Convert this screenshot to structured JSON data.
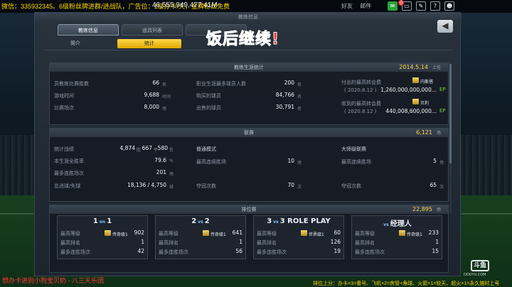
{
  "stream": {
    "marquee": "微信：335932345。6级粉丝牌进群/进战队，广告位：1级办卡/天，金牌粉丝免费",
    "money": "46,555,949,477.41M",
    "top_links": [
      "好友",
      "邮件"
    ],
    "notif_count": "0",
    "bottom_left": "想办卡进别小狗宝贝奶 - 八三天乐团",
    "bottom_right": "排位上分：办卡×3=看号、飞机×2=房管+角球、火箭×1=较天、超火×1=永久随时上号",
    "logo_text": "斗鱼",
    "logo_url": "DOUYU.COM"
  },
  "overlay_caption": "饭后继续!",
  "panel": {
    "title": "教练信息",
    "tabs": [
      "教练信息",
      "道具列表",
      ""
    ],
    "subtabs": [
      "简介",
      "统计"
    ],
    "back_icon": "back-arrow-icon"
  },
  "career": {
    "title": "教练生涯统计",
    "date": "2014.5.14",
    "date_suffix": "上任",
    "col1": [
      {
        "label": "员教练比赛胜数",
        "value": "66",
        "unit": "名"
      },
      {
        "label": "游戏时间",
        "value": "9,688",
        "unit": "时间"
      },
      {
        "label": "比赛场次",
        "value": "8,000",
        "unit": "场"
      }
    ],
    "col2": [
      {
        "label": "职业生涯最多球员人数",
        "value": "200",
        "unit": "名"
      },
      {
        "label": "购买的球员",
        "value": "84,766",
        "unit": "名"
      },
      {
        "label": "出售的球员",
        "value": "30,791",
        "unit": "名"
      }
    ],
    "col3": [
      {
        "label": "付出的最高转会费",
        "date": "( 2020.8.12 )",
        "value": "1,260,000,000,000...",
        "player": "内斯塔",
        "ep": "EP"
      },
      {
        "label": "收到的最高转会费",
        "date": "( 2020.8.12 )",
        "value": "440,008,600,000...",
        "player": "贝利",
        "ep": "EP"
      }
    ]
  },
  "league": {
    "title": "联赛",
    "score": "6,121",
    "score_unit": "场",
    "col1": [
      {
        "label": "统计战绩",
        "w": "4,874",
        "d": "667",
        "l": "580",
        "unit": "胜"
      },
      {
        "label": "本生涯全胜率",
        "value": "79.6",
        "unit": "%"
      },
      {
        "label": "最多连胜场次",
        "value": "201",
        "unit": "场"
      },
      {
        "label": "总进球/失球",
        "value": "18,136 / 4,750",
        "unit": "球"
      }
    ],
    "col2": [
      {
        "label": "普通模式",
        "value": "",
        "unit": ""
      },
      {
        "label": "最高连续胜场",
        "value": "10",
        "unit": "场"
      },
      {
        "label": "夺冠次数",
        "value": "70",
        "unit": "次"
      }
    ],
    "col3": [
      {
        "label": "大师级联赛",
        "value": "",
        "unit": ""
      },
      {
        "label": "最高连续胜场",
        "value": "5",
        "unit": "场"
      },
      {
        "label": "夺冠次数",
        "value": "65",
        "unit": "次"
      }
    ]
  },
  "ranked": {
    "title": "排位赛",
    "score": "22,895",
    "score_unit": "场",
    "modes": [
      {
        "title": "1",
        "sub": "on",
        "title2": "1",
        "rows": [
          {
            "label": "最高等级",
            "badge": "传奇级1",
            "value": "902"
          },
          {
            "label": "最高排名",
            "badge": "",
            "value": "1"
          },
          {
            "label": "最多连胜场次",
            "badge": "",
            "value": "42"
          }
        ]
      },
      {
        "title": "2",
        "sub": "vs",
        "title2": "2",
        "rows": [
          {
            "label": "最高等级",
            "badge": "传奇级1",
            "value": "641"
          },
          {
            "label": "最高排名",
            "badge": "",
            "value": "1"
          },
          {
            "label": "最多连胜场次",
            "badge": "",
            "value": "56"
          }
        ]
      },
      {
        "title": "3",
        "sub": "vs",
        "title2": "3 ROLE PLAY",
        "rows": [
          {
            "label": "最高等级",
            "badge": "世界级1",
            "value": "60"
          },
          {
            "label": "最高排名",
            "badge": "",
            "value": "126"
          },
          {
            "label": "最多连胜场次",
            "badge": "",
            "value": "19"
          }
        ]
      },
      {
        "title": "",
        "sub": "vs",
        "title2": "经理人",
        "rows": [
          {
            "label": "最高等级",
            "badge": "传奇级1",
            "value": "233"
          },
          {
            "label": "最高排名",
            "badge": "",
            "value": "1"
          },
          {
            "label": "最多连胜场次",
            "badge": "",
            "value": "15"
          }
        ]
      }
    ]
  }
}
